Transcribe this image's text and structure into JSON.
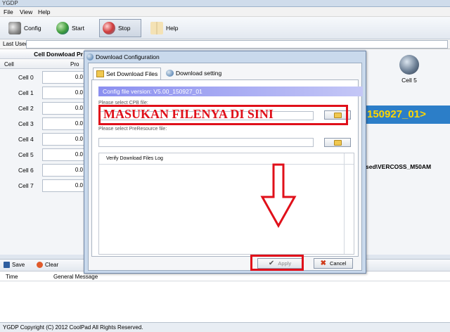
{
  "window": {
    "title": "YGDP"
  },
  "menu": [
    "File",
    "View",
    "Help"
  ],
  "toolbar": {
    "config": "Config",
    "start": "Start",
    "stop": "Stop",
    "help": "Help"
  },
  "last_used": {
    "label": "Last Used:",
    "value": ""
  },
  "cells_panel": {
    "header": "Cell Donwload Pr",
    "col_cell": "Cell",
    "col_progress": "Pro",
    "rows": [
      {
        "name": "Cell 0",
        "progress": "0.0"
      },
      {
        "name": "Cell 1",
        "progress": "0.0"
      },
      {
        "name": "Cell 2",
        "progress": "0.0"
      },
      {
        "name": "Cell 3",
        "progress": "0.0"
      },
      {
        "name": "Cell 4",
        "progress": "0.0"
      },
      {
        "name": "Cell 5",
        "progress": "0.0"
      },
      {
        "name": "Cell 6",
        "progress": "0.0"
      },
      {
        "name": "Cell 7",
        "progress": "0.0"
      }
    ]
  },
  "right_panel": {
    "cell_label": "Cell 5",
    "version_text": "150927_01>",
    "path_text": "sed\\VERCOSS_M50AM"
  },
  "dialog": {
    "title": "Download Configuration",
    "tabs": [
      "Set Download Files",
      "Download setting"
    ],
    "config_version": "Config file version: V5.00_150927_01",
    "cpb_label": "Please select CPB file:",
    "cpb_value": "",
    "preresource_label": "Please select PreResource file:",
    "preresource_value": "",
    "log_header": "Verify Download Files Log",
    "apply": "Apply",
    "cancel": "Cancel"
  },
  "log_panel": {
    "save": "Save",
    "clear": "Clear",
    "col_time": "Time",
    "col_message": "General Message"
  },
  "status_bar": "YGDP Copyright (C) 2012 CoolPad All Rights Reserved.",
  "annotation": {
    "text": "MASUKAN FILENYA DI SINI",
    "color": "#e0101a"
  }
}
